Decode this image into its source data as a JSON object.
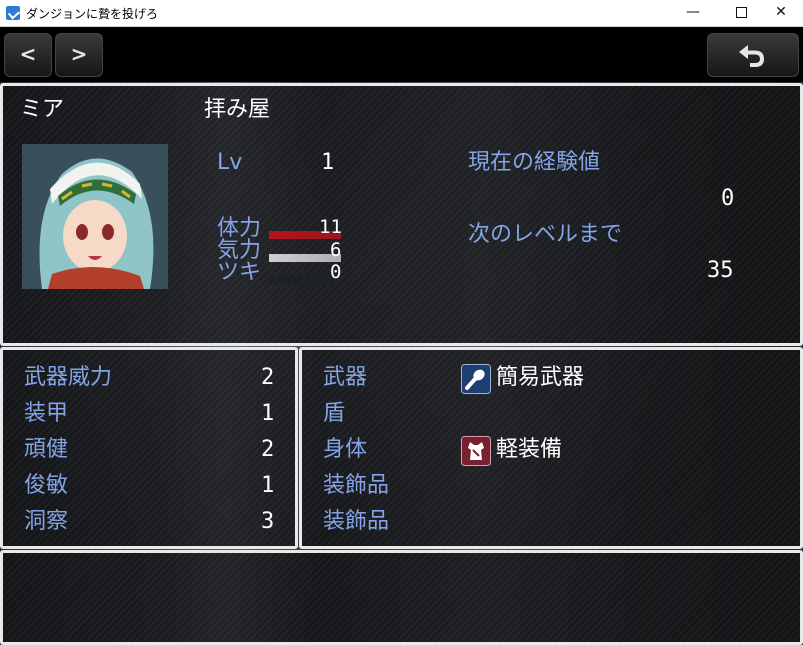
{
  "window": {
    "title": "ダンジョンに贄を投げろ",
    "minimize": "—",
    "close": "✕"
  },
  "nav": {
    "prev_label": "<",
    "next_label": ">",
    "back_icon": "back-arrow-icon"
  },
  "status": {
    "name": "ミア",
    "class_name": "拝み屋",
    "level_label": "Lv",
    "level": "1",
    "exp_label": "現在の経験値",
    "exp_value": "0",
    "next_label": "次のレベルまで",
    "next_value": "35",
    "gauges": [
      {
        "label": "体力",
        "value": "11",
        "fill": 1.0,
        "color": "#b5141c"
      },
      {
        "label": "気力",
        "value": "6",
        "fill": 1.0,
        "color": "#cfcfcf"
      },
      {
        "label": "ツキ",
        "value": "0",
        "fill": 0.0,
        "color": "#3b4a8c"
      }
    ]
  },
  "params": [
    {
      "label": "武器威力",
      "value": "2"
    },
    {
      "label": "装甲",
      "value": "1"
    },
    {
      "label": "頑健",
      "value": "2"
    },
    {
      "label": "俊敏",
      "value": "1"
    },
    {
      "label": "洞察",
      "value": "3"
    }
  ],
  "equipment": [
    {
      "slot": "武器",
      "item": "簡易武器",
      "icon": "club-weapon-icon"
    },
    {
      "slot": "盾",
      "item": "",
      "icon": ""
    },
    {
      "slot": "身体",
      "item": "軽装備",
      "icon": "light-armor-icon"
    },
    {
      "slot": "装飾品",
      "item": "",
      "icon": ""
    },
    {
      "slot": "装飾品",
      "item": "",
      "icon": ""
    }
  ],
  "colors": {
    "system_text": "#84a4e6",
    "normal_text": "#ffffff",
    "window_border": "#e9e9e9"
  }
}
